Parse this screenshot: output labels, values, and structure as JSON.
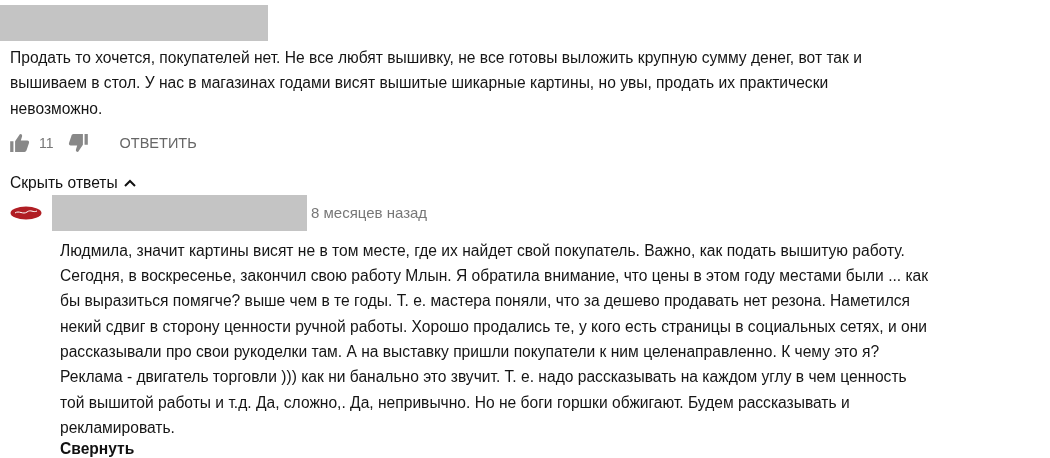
{
  "comment": {
    "text_lines": [
      "Продать то хочется, покупателей нет. Не все любят вышивку, не все готовы выложить крупную сумму денег, вот так и",
      "вышиваем в стол. У нас в магазинах годами висят вышитые шикарные картины, но увы, продать их практически",
      "невозможно."
    ],
    "likes": "11",
    "reply_button": "ОТВЕТИТЬ"
  },
  "hide_replies": "Скрыть ответы",
  "reply": {
    "time": "8 месяцев назад",
    "text_lines": [
      "Людмила, значит картины висят не в том месте, где их найдет свой покупатель. Важно, как подать вышитую работу.",
      "Сегодня, в воскресенье, закончил свою работу Млын. Я обратила внимание, что цены в этом году местами были ... как",
      "бы выразиться помягче? выше чем в те годы. Т. е. мастера поняли, что за дешево продавать нет резона. Наметился",
      "некий сдвиг в сторону ценности ручной работы. Хорошо продались те, у кого есть страницы в социальных сетях, и они",
      "рассказывали про свои рукоделки там. А на выставку пришли покупатели к ним целенаправленно. К чему это я?",
      "Реклама - двигатель торговли ))) как ни банально это звучит. Т. е. надо рассказывать на каждом углу в чем ценность",
      "той вышитой работы и т.д. Да, сложно,. Да, непривычно. Но не боги горшки обжигают. Будем рассказывать и",
      "рекламировать."
    ],
    "collapse": "Свернуть"
  }
}
